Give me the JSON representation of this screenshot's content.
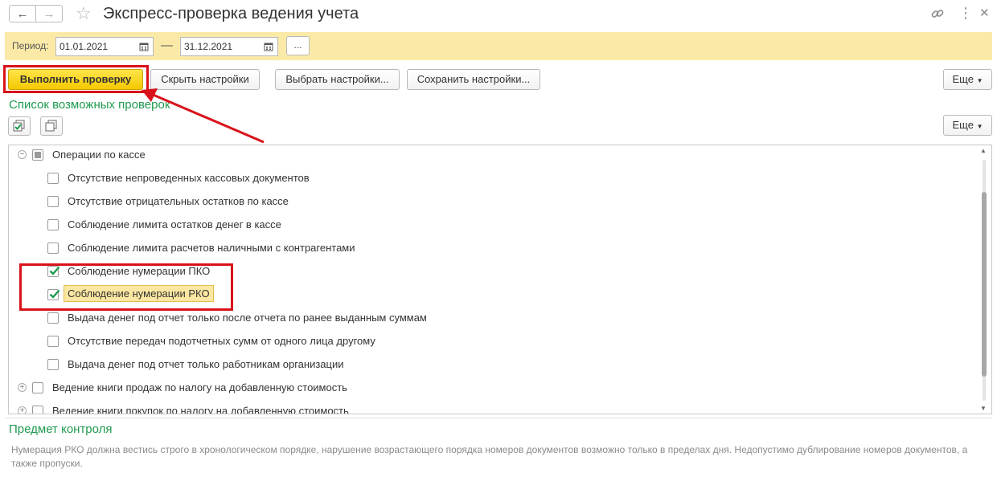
{
  "window": {
    "title": "Экспресс-проверка ведения учета",
    "back_icon": "arrow-left-icon",
    "forward_icon": "arrow-right-icon"
  },
  "period": {
    "label": "Период:",
    "date_from": "01.01.2021",
    "date_to": "31.12.2021",
    "separator": "—",
    "more_label": "..."
  },
  "toolbar": {
    "run_label": "Выполнить проверку",
    "hide_label": "Скрыть настройки",
    "select_label": "Выбрать настройки...",
    "save_label": "Сохранить настройки...",
    "more_label": "Еще"
  },
  "checks_list": {
    "title": "Список возможных проверок",
    "more_label": "Еще",
    "items": [
      {
        "label": "Операции по кассе",
        "level": 0,
        "state": "mixed",
        "expander": "minus"
      },
      {
        "label": "Отсутствие непроведенных кассовых документов",
        "level": 1,
        "state": "unchecked"
      },
      {
        "label": "Отсутствие отрицательных остатков по кассе",
        "level": 1,
        "state": "unchecked"
      },
      {
        "label": "Соблюдение лимита остатков денег в кассе",
        "level": 1,
        "state": "unchecked"
      },
      {
        "label": "Соблюдение лимита расчетов наличными с контрагентами",
        "level": 1,
        "state": "unchecked"
      },
      {
        "label": "Соблюдение нумерации ПКО",
        "level": 1,
        "state": "checked"
      },
      {
        "label": "Соблюдение нумерации РКО",
        "level": 1,
        "state": "checked",
        "focused": true
      },
      {
        "label": "Выдача денег под отчет только после отчета по ранее выданным суммам",
        "level": 1,
        "state": "unchecked"
      },
      {
        "label": "Отсутствие передач подотчетных сумм от одного лица другому",
        "level": 1,
        "state": "unchecked"
      },
      {
        "label": "Выдача денег под отчет только работникам организации",
        "level": 1,
        "state": "unchecked"
      },
      {
        "label": "Ведение книги продаж по налогу на добавленную стоимость",
        "level": 0,
        "state": "unchecked",
        "expander": "plus"
      },
      {
        "label": "Ведение книги покупок по налогу на добавленную стоимость",
        "level": 0,
        "state": "unchecked",
        "expander": "plus"
      }
    ]
  },
  "control_subject": {
    "title": "Предмет контроля",
    "text": "Нумерация РКО должна вестись строго в хронологическом порядке, нарушение возрастающего порядка номеров документов возможно только в пределах дня. Недопустимо дублирование номеров документов, а также пропуски."
  },
  "colors": {
    "accent_green": "#1f9a4f",
    "highlight_red": "#d8121a",
    "period_bar": "#fbeaa7",
    "primary_button": "#f5c800"
  }
}
